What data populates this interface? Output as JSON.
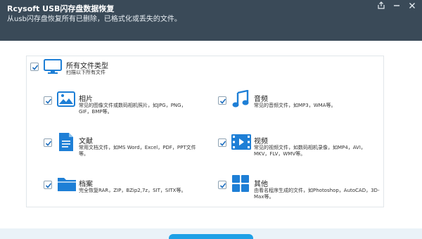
{
  "window": {
    "title": "Rcysoft USB闪存盘数据恢复",
    "subtitle": "从usb闪存盘恢复所有已删除，已格式化或丢失的文件。"
  },
  "all_types": {
    "label": "所有文件类型",
    "desc": "扫描以下所有文件",
    "checked": true
  },
  "categories": [
    {
      "key": "image",
      "label": "相片",
      "desc": "常见的图像文件或数码相机照片，如JPG，PNG，GIF，BMP等。",
      "icon": "image-icon",
      "checked": true
    },
    {
      "key": "audio",
      "label": "音频",
      "desc": "常见的音频文件，如MP3，WMA等。",
      "icon": "music-note-icon",
      "checked": true
    },
    {
      "key": "document",
      "label": "文献",
      "desc": "常用文档文件，如MS Word，Excel，PDF，PPT文件等。",
      "icon": "document-icon",
      "checked": true
    },
    {
      "key": "video",
      "label": "视频",
      "desc": "常见的视频文件，如数码相机录像，如MP4，AVI，MKV，FLV，WMV等。",
      "icon": "film-icon",
      "checked": true
    },
    {
      "key": "archive",
      "label": "档案",
      "desc": "完全恢复RAR，ZIP，BZip2,7z，SIT，SITX等。",
      "icon": "folder-icon",
      "checked": true
    },
    {
      "key": "other",
      "label": "其他",
      "desc": "由看名程序生成的文件，如Photoshop，AutoCAD，3D-Max等。",
      "icon": "grid-icon",
      "checked": true
    }
  ],
  "colors": {
    "titlebar_bg": "#3a4a58",
    "accent": "#1e7fd6",
    "button": "#1ea0e6",
    "bottom_band": "#eaf2f8"
  }
}
